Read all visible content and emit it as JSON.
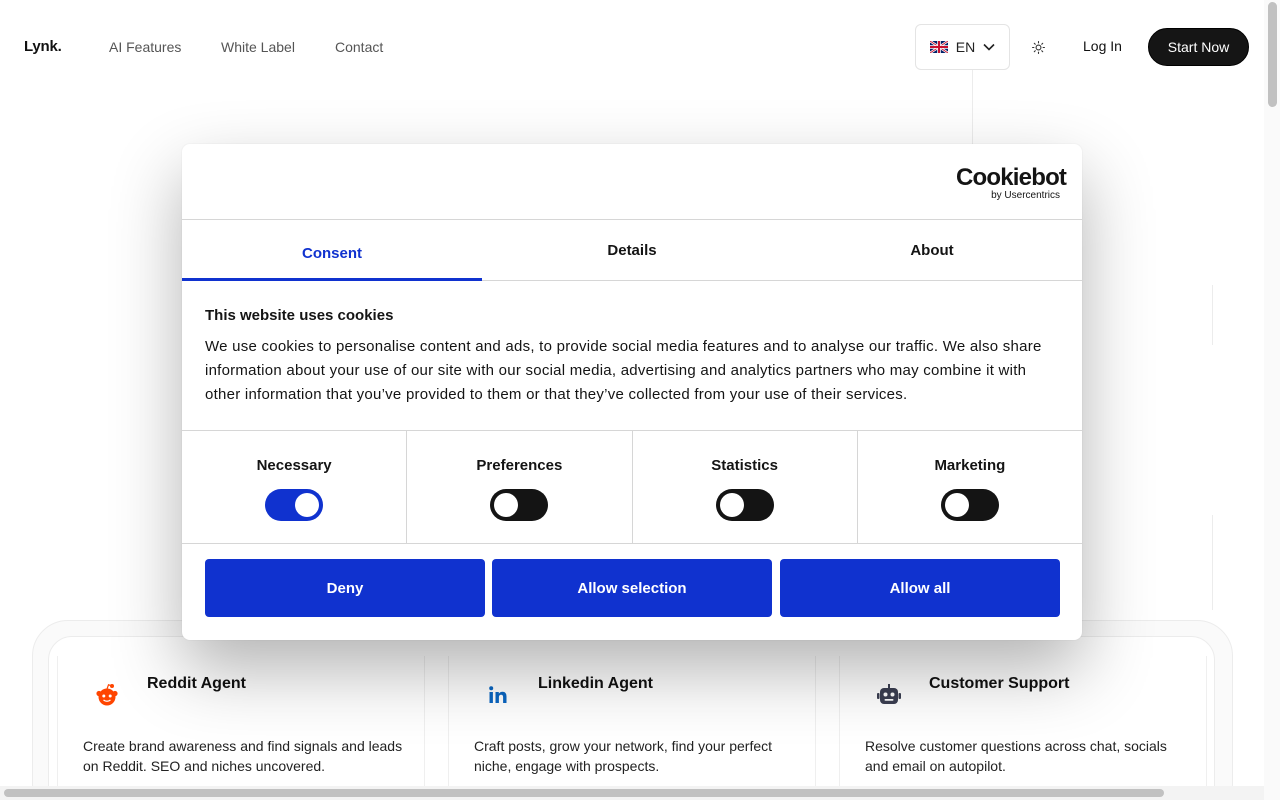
{
  "nav": {
    "logo": "Lynk.",
    "links": [
      "AI Features",
      "White Label",
      "Contact"
    ],
    "language": "EN",
    "login": "Log In",
    "cta": "Start Now"
  },
  "cards": [
    {
      "title": "Reddit Agent",
      "icon": "reddit-icon",
      "description": "Create brand awareness and find signals and leads on Reddit. SEO and niches uncovered."
    },
    {
      "title": "Linkedin Agent",
      "icon": "linkedin-icon",
      "description": "Craft posts, grow your network, find your perfect niche, engage with prospects."
    },
    {
      "title": "Customer Support",
      "icon": "robot-icon",
      "description": "Resolve customer questions across chat, socials and email on autopilot."
    }
  ],
  "cookie": {
    "brand": "Cookiebot",
    "brand_sub": "by Usercentrics",
    "tabs": [
      "Consent",
      "Details",
      "About"
    ],
    "active_tab": "Consent",
    "title": "This website uses cookies",
    "text": "We use cookies to personalise content and ads, to provide social media features and to analyse our traffic. We also share information about your use of our site with our social media, advertising and analytics partners who may combine it with other information that you’ve provided to them or that they’ve collected from your use of their services.",
    "categories": [
      {
        "label": "Necessary",
        "enabled": true
      },
      {
        "label": "Preferences",
        "enabled": false
      },
      {
        "label": "Statistics",
        "enabled": false
      },
      {
        "label": "Marketing",
        "enabled": false
      }
    ],
    "buttons": {
      "deny": "Deny",
      "allow_selection": "Allow selection",
      "allow_all": "Allow all"
    }
  },
  "colors": {
    "accent": "#1032cf",
    "dark": "#141414",
    "reddit": "#ff4500",
    "linkedin": "#0a66c2"
  }
}
